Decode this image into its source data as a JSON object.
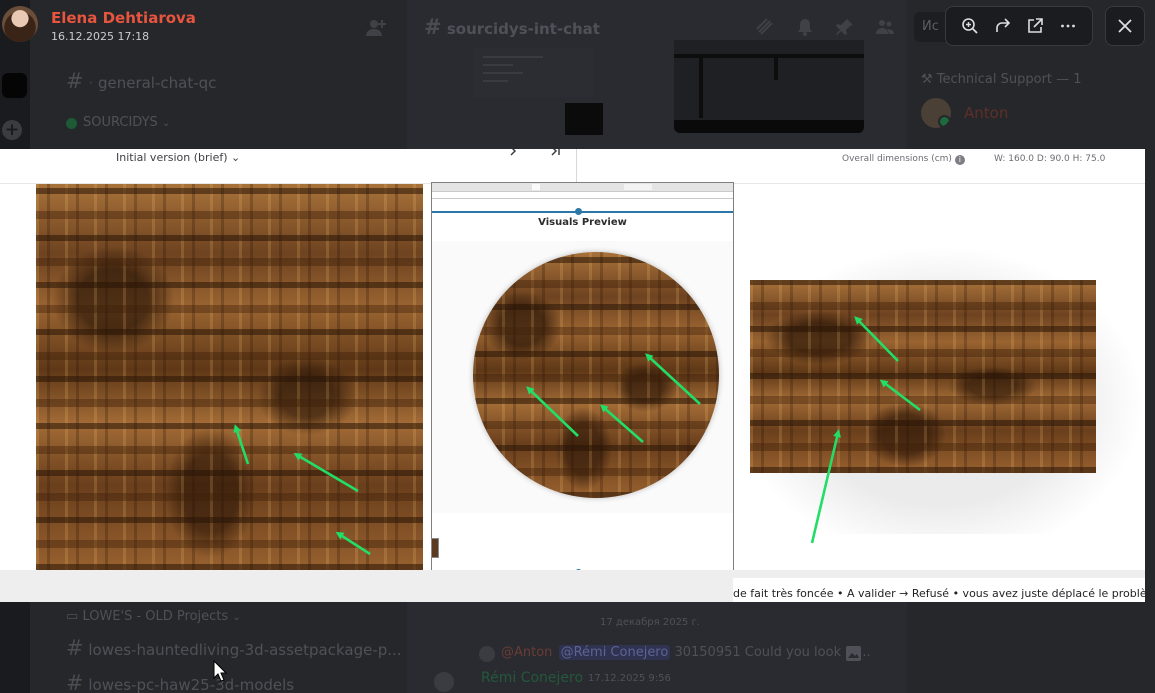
{
  "viewer": {
    "author_name": "Elena Dehtiarova",
    "timestamp": "16.12.2025 17:18",
    "toolbar": {
      "zoom_icon": "zoom-in-icon",
      "forward_icon": "forward-icon",
      "open_icon": "open-in-browser-icon",
      "more_icon": "more-icon",
      "close_icon": "close-icon"
    }
  },
  "image": {
    "header_left": "Initial version (brief)",
    "dims_label": "Overall dimensions (cm)",
    "dims_values": "W: 160.0   D: 90.0   H: 75.0",
    "middle_title": "Visuals Preview",
    "bottom_note": "de fait très foncée • A valider → Refusé • vous avez juste déplacé le problème",
    "arrow_color": "#22dd66"
  },
  "background": {
    "channel_header": "sourcidys-int-chat",
    "search_text": "Ис",
    "channel_general": "general-chat-qc",
    "category_sourcidys": "SOURCIDYS",
    "category_lowes": "LOWE'S - OLD Projects",
    "channel_haunted": "lowes-hauntedliving-3d-assetpackage-p...",
    "channel_pc": "lowes-pc-haw25-3d-models",
    "members_category": "Technical Support — 1",
    "member_name": "Anton",
    "date_divider": "17 декабря 2025 г.",
    "reply_mention": "@Anton",
    "reply_mention2": "@Rémi Conejero",
    "reply_text": "30150951 Could you look at...",
    "message_author": "Rémi Conejero",
    "message_time": "17.12.2025 9:56"
  }
}
